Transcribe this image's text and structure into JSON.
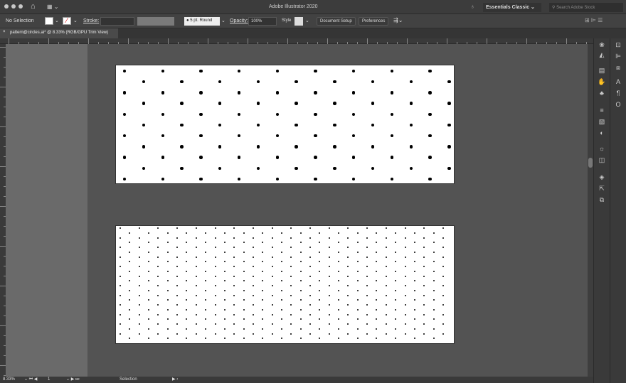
{
  "app": {
    "title": "Adobe Illustrator 2020",
    "workspace": "Essentials Classic",
    "search_placeholder": "Search Adobe Stock"
  },
  "control": {
    "selection": "No Selection",
    "stroke_label": "Stroke:",
    "brush": "5 pt. Round",
    "opacity_label": "Opacity:",
    "opacity": "100%",
    "style_label": "Style",
    "document_setup": "Document Setup",
    "preferences": "Preferences"
  },
  "tab": {
    "title": "pattern@circles.ai* @ 8.33% (RGB/GPU Trim View)"
  },
  "status": {
    "zoom": "8.33%",
    "artboard": "1",
    "tool": "Selection"
  },
  "icons": {
    "home": "home-icon",
    "layout": "workspace-layout-icon",
    "lightbulb": "lightbulb-icon",
    "search": "search-icon"
  },
  "colors": {
    "chrome": "#3c3c3c",
    "canvas": "#535353",
    "artboard": "#ffffff",
    "dot": "#000000"
  }
}
